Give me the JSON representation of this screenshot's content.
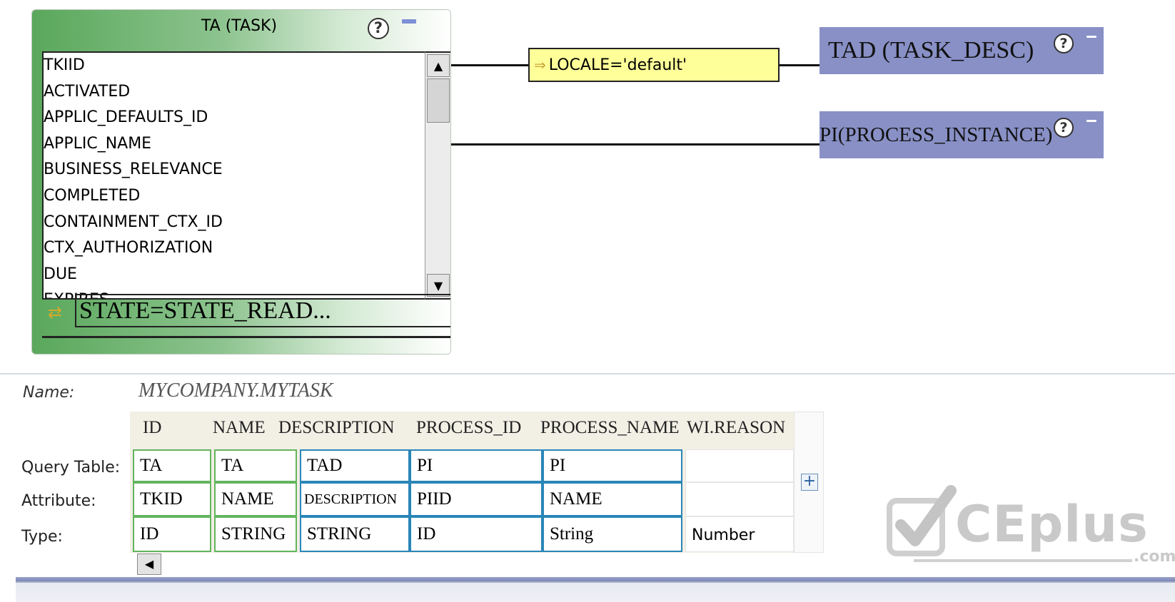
{
  "task_box": {
    "title": "TA (TASK)",
    "attributes": [
      "TKIID",
      "ACTIVATED",
      "APPLIC_DEFAULTS_ID",
      "APPLIC_NAME",
      "BUSINESS_RELEVANCE",
      "COMPLETED",
      "CONTAINMENT_CTX_ID",
      "CTX_AUTHORIZATION",
      "DUE",
      "EXPIRES"
    ],
    "filter": "STATE=STATE_READ..."
  },
  "join_condition": "LOCALE='default'",
  "related_tables": [
    {
      "label": "TAD (TASK_DESC)"
    },
    {
      "label": "PI(PROCESS_INSTANCE)"
    }
  ],
  "help_icon_glyph": "?",
  "details": {
    "name_label": "Name:",
    "name_value": "MYCOMPANY.MYTASK",
    "columns": [
      "ID",
      "NAME",
      "DESCRIPTION",
      "PROCESS_ID",
      "PROCESS_NAME",
      "WI.REASON"
    ],
    "row_labels": {
      "query_table": "Query Table:",
      "attribute": "Attribute:",
      "type": "Type:"
    },
    "rows": {
      "query_table": [
        "TA",
        "TA",
        "TAD",
        "PI",
        "PI",
        ""
      ],
      "attribute": [
        "TKID",
        "NAME",
        "DESCRIPTION",
        "PIID",
        "NAME",
        ""
      ],
      "type": [
        "ID",
        "STRING",
        "STRING",
        "ID",
        "String",
        "Number"
      ]
    },
    "add_button": "+"
  },
  "icons": {
    "help": "question-mark-icon",
    "minimize": "minimize-icon",
    "filter": "filter-icon",
    "join": "join-icon",
    "add": "plus-icon",
    "scroll_up": "scroll-up-arrow-icon",
    "scroll_down": "scroll-down-arrow-icon",
    "scroll_left": "scroll-left-arrow-icon"
  },
  "watermark": {
    "text": "CEplus",
    "suffix": ".com"
  },
  "colors": {
    "task_header_green": "#5aa85c",
    "join_box_blue": "#8890c6",
    "condition_yellow": "#ffff99",
    "grid_green": "#63b55e",
    "grid_blue": "#2a86b8"
  }
}
